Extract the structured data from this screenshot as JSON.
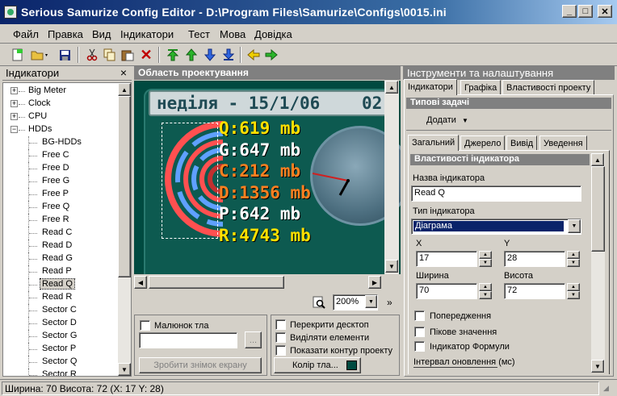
{
  "window": {
    "title": "Serious Samurize Config Editor - D:\\Program Files\\Samurize\\Configs\\0015.ini",
    "minimize": "_",
    "maximize": "□",
    "close": "✕"
  },
  "menu": [
    {
      "label": "Файл"
    },
    {
      "label": "Правка"
    },
    {
      "label": "Вид"
    },
    {
      "label": "Індикатори"
    },
    {
      "label": "Тест"
    },
    {
      "label": "Мова"
    },
    {
      "label": "Довідка"
    }
  ],
  "toolbar": {
    "icons": [
      "new-icon",
      "open-icon",
      "save-icon",
      "cut-icon",
      "copy-icon",
      "paste-icon",
      "delete-icon",
      "move-top-icon",
      "move-up-icon",
      "move-down-icon",
      "move-bottom-icon",
      "back-icon",
      "forward-icon"
    ]
  },
  "left_panel": {
    "title": "Індикатори",
    "close": "×",
    "tree": [
      {
        "label": "Big Meter",
        "level": 0,
        "expander": "+"
      },
      {
        "label": "Clock",
        "level": 0,
        "expander": "+"
      },
      {
        "label": "CPU",
        "level": 0,
        "expander": "+"
      },
      {
        "label": "HDDs",
        "level": 0,
        "expander": "−"
      },
      {
        "label": "BG-HDDs",
        "level": 1
      },
      {
        "label": "Free C",
        "level": 1
      },
      {
        "label": "Free D",
        "level": 1
      },
      {
        "label": "Free G",
        "level": 1
      },
      {
        "label": "Free P",
        "level": 1
      },
      {
        "label": "Free Q",
        "level": 1
      },
      {
        "label": "Free R",
        "level": 1
      },
      {
        "label": "Read C",
        "level": 1
      },
      {
        "label": "Read D",
        "level": 1
      },
      {
        "label": "Read G",
        "level": 1
      },
      {
        "label": "Read P",
        "level": 1
      },
      {
        "label": "Read Q",
        "level": 1,
        "selected": true
      },
      {
        "label": "Read R",
        "level": 1
      },
      {
        "label": "Sector C",
        "level": 1
      },
      {
        "label": "Sector D",
        "level": 1
      },
      {
        "label": "Sector G",
        "level": 1
      },
      {
        "label": "Sector P",
        "level": 1
      },
      {
        "label": "Sector Q",
        "level": 1
      },
      {
        "label": "Sector R",
        "level": 1
      }
    ]
  },
  "design_area": {
    "title": "Область проектування",
    "date_text": "неділя - 15/1/06",
    "time_text": "02",
    "readouts": [
      {
        "text": "Q:619 mb",
        "color": "#ffe000"
      },
      {
        "text": "G:647 mb",
        "color": "#ffffff"
      },
      {
        "text": "C:212 mb",
        "color": "#ff8020"
      },
      {
        "text": "D:1356 mb",
        "color": "#ff8020"
      },
      {
        "text": "P:642 mb",
        "color": "#ffffff"
      },
      {
        "text": "R:4743 mb",
        "color": "#ffe000"
      }
    ],
    "zoom": "200%"
  },
  "bottom_options": {
    "background_image_label": "Малюнок тла",
    "browse": "...",
    "screenshot_button": "Зробити знімок екрану",
    "overlap_desktop": "Перекрити десктоп",
    "highlight_elements": "Виділяти елементи",
    "show_outline": "Показати контур проекту",
    "bg_color_button": "Колір тла...",
    "bg_color": "#004a40"
  },
  "right_panel": {
    "title": "Інструменти та налаштування",
    "tabs": [
      "Індикатори",
      "Графіка",
      "Властивості проекту"
    ],
    "typical_tasks": "Типові задачі",
    "add_button": "Додати",
    "subtabs": [
      "Загальний",
      "Джерело",
      "Вивід",
      "Уведення"
    ],
    "props_header": "Властивості індикатора",
    "name_label": "Назва індикатора",
    "name_value": "Read Q",
    "type_label": "Тип індикатора",
    "type_value": "Діаграма",
    "x_label": "X",
    "x_value": "17",
    "y_label": "Y",
    "y_value": "28",
    "width_label": "Ширина",
    "width_value": "70",
    "height_label": "Висота",
    "height_value": "72",
    "warnings": "Попередження",
    "peak_value": "Пікове значення",
    "formula_indicator": "Індикатор Формули",
    "update_interval": "Інтервал оновлення (мс)"
  },
  "status": {
    "text": "Ширина: 70  Висота: 72  (X: 17  Y: 28)"
  }
}
